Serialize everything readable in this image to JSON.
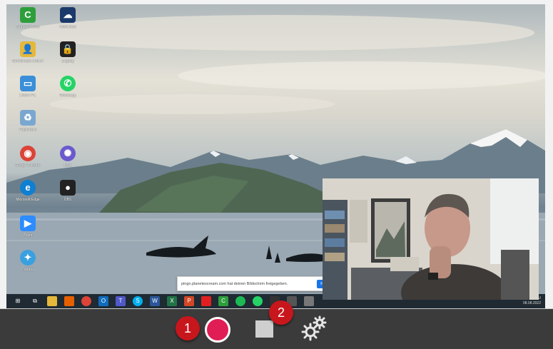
{
  "desktop_icons": [
    {
      "label": "Camtasia 2020",
      "color": "#2e9e3c",
      "glyph": "C"
    },
    {
      "label": "OwnCloud",
      "color": "#1b3a6b",
      "glyph": "☁"
    },
    {
      "label": "Gemeinsam Ordner",
      "color": "#e5b73b",
      "glyph": "👤"
    },
    {
      "label": "Zugang",
      "color": "#222222",
      "glyph": "🔒"
    },
    {
      "label": "Dieser PC",
      "color": "#3a8fd8",
      "glyph": "▭"
    },
    {
      "label": "WhatsApp",
      "color": "#25d366",
      "glyph": "✆"
    },
    {
      "label": "Papierkorb",
      "color": "#7aa7cf",
      "glyph": "♻"
    },
    {
      "label": "Google Chrome",
      "color": "#db4437",
      "glyph": "◉"
    },
    {
      "label": "Ionic",
      "color": "#6a5acd",
      "glyph": "✺"
    },
    {
      "label": "Microsoft Edge",
      "color": "#0f7fd1",
      "glyph": "e"
    },
    {
      "label": "OBS",
      "color": "#222222",
      "glyph": "●"
    },
    {
      "label": "Zoom",
      "color": "#2d8cff",
      "glyph": "▶"
    },
    {
      "label": "Cortana",
      "color": "#3aa0e0",
      "glyph": "✦"
    }
  ],
  "share_banner": {
    "text": "pingo.planetescream.com hat deinen Bildschirm freigegeben.",
    "button": "Freigabe"
  },
  "taskbar": {
    "time": "08.08.2022",
    "tray_label": "DEU"
  },
  "controls": {
    "badge_record": "1",
    "badge_stop": "2",
    "record_color": "#e01e55",
    "badge_color": "#c8161d"
  }
}
